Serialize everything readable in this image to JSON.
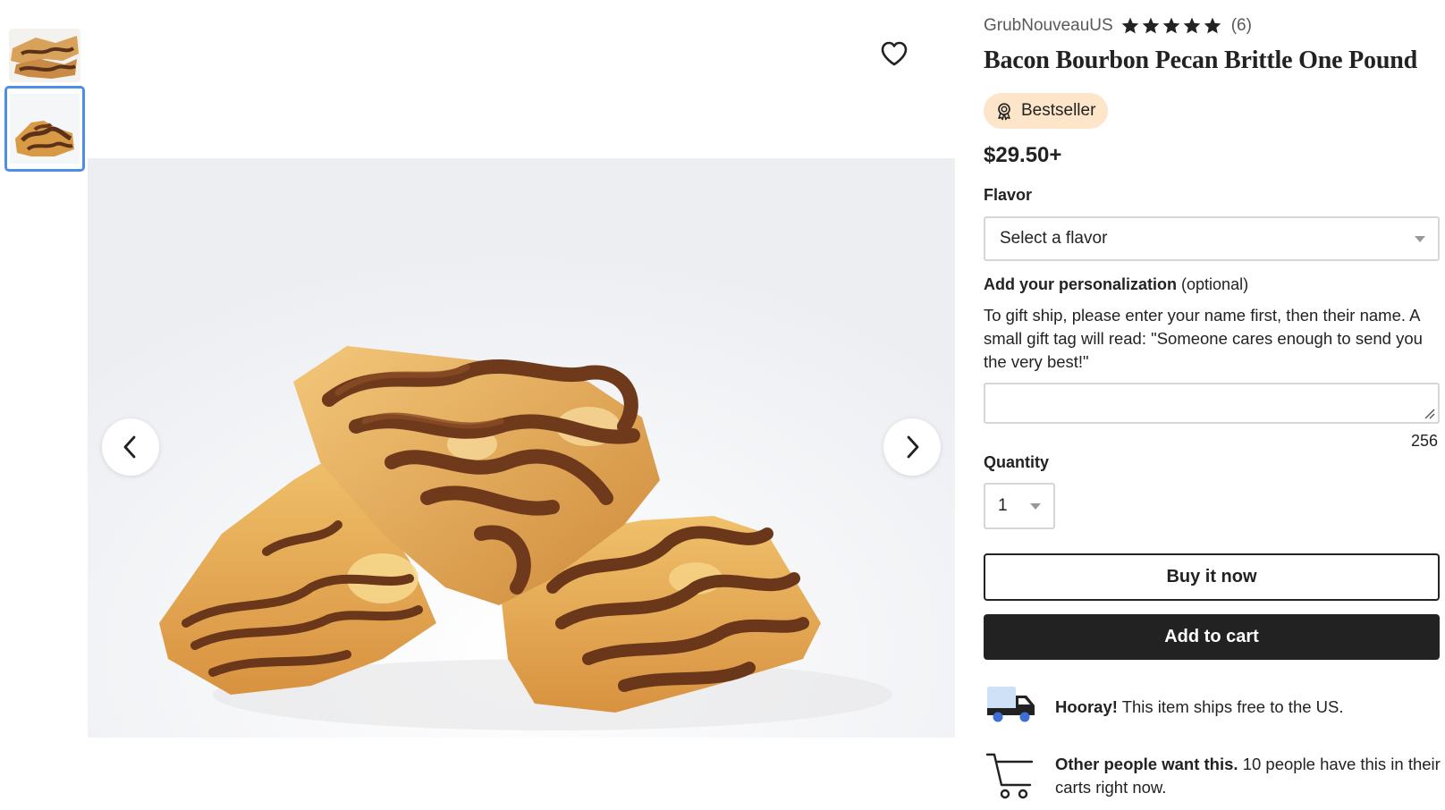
{
  "thumbnails": [
    {
      "alt": "brittle-thumbnail-1",
      "selected": false
    },
    {
      "alt": "brittle-thumbnail-2",
      "selected": true
    }
  ],
  "gallery": {
    "favorite_icon": "heart-outline-icon",
    "prev_icon": "chevron-left-icon",
    "next_icon": "chevron-right-icon"
  },
  "listing": {
    "shop_name": "GrubNouveauUS",
    "rating_stars": 5,
    "review_count": "(6)",
    "title": "Bacon Bourbon Pecan Brittle One Pound",
    "badge": "Bestseller",
    "price": "$29.50+"
  },
  "flavor": {
    "label": "Flavor",
    "selected": "Select a flavor"
  },
  "personalization": {
    "label": "Add your personalization",
    "optional": " (optional)",
    "help": "To gift ship, please enter your name first, then their name. A small gift tag will read: \"Someone cares enough to send you the very best!\"",
    "value": "",
    "char_remaining": "256"
  },
  "quantity": {
    "label": "Quantity",
    "selected": "1"
  },
  "actions": {
    "buy_now": "Buy it now",
    "add_to_cart": "Add to cart"
  },
  "shipping": {
    "icon": "delivery-truck-icon",
    "bold": "Hooray!",
    "text": " This item ships free to the US."
  },
  "demand": {
    "icon": "shopping-cart-icon",
    "bold": "Other people want this.",
    "text": " 10 people have this in their carts right now."
  },
  "colors": {
    "accent_selected_border": "#4d8fe6",
    "badge_bg": "#fde5c9",
    "cart_button_bg": "#222222",
    "truck_cab": "#222222",
    "truck_box": "#cfe1f7",
    "truck_wheels": "#3d6fd6"
  }
}
